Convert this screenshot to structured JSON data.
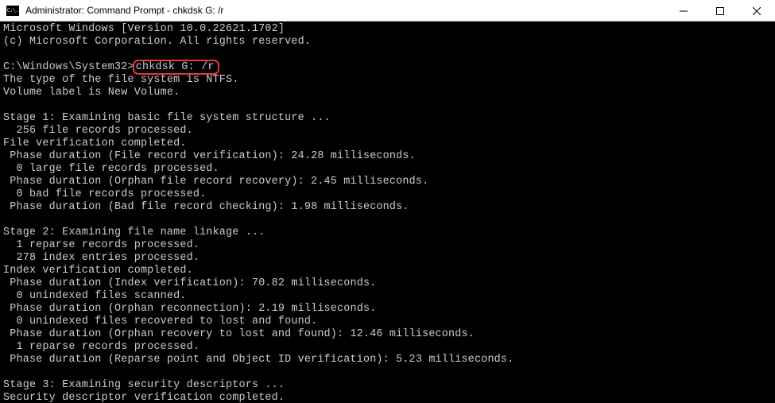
{
  "titlebar": {
    "icon_text": "C:\\.",
    "title": "Administrator: Command Prompt - chkdsk  G: /r"
  },
  "terminal": {
    "header1": "Microsoft Windows [Version 10.0.22621.1702]",
    "header2": "(c) Microsoft Corporation. All rights reserved.",
    "prompt": "C:\\Windows\\System32>",
    "command": "chkdsk G: /r",
    "fs_type": "The type of the file system is NTFS.",
    "volume_label": "Volume label is New Volume.",
    "stage1_title": "Stage 1: Examining basic file system structure ...",
    "stage1_records": "  256 file records processed.",
    "stage1_verif": "File verification completed.",
    "stage1_p1": " Phase duration (File record verification): 24.28 milliseconds.",
    "stage1_large": "  0 large file records processed.",
    "stage1_p2": " Phase duration (Orphan file record recovery): 2.45 milliseconds.",
    "stage1_bad": "  0 bad file records processed.",
    "stage1_p3": " Phase duration (Bad file record checking): 1.98 milliseconds.",
    "stage2_title": "Stage 2: Examining file name linkage ...",
    "stage2_reparse": "  1 reparse records processed.",
    "stage2_index": "  278 index entries processed.",
    "stage2_verif": "Index verification completed.",
    "stage2_p1": " Phase duration (Index verification): 70.82 milliseconds.",
    "stage2_scan": "  0 unindexed files scanned.",
    "stage2_p2": " Phase duration (Orphan reconnection): 2.19 milliseconds.",
    "stage2_recov": "  0 unindexed files recovered to lost and found.",
    "stage2_p3": " Phase duration (Orphan recovery to lost and found): 12.46 milliseconds.",
    "stage2_reparse2": "  1 reparse records processed.",
    "stage2_p4": " Phase duration (Reparse point and Object ID verification): 5.23 milliseconds.",
    "stage3_title": "Stage 3: Examining security descriptors ...",
    "stage3_verif": "Security descriptor verification completed."
  }
}
